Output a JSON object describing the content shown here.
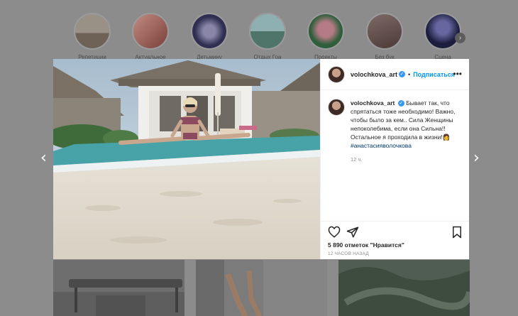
{
  "stories": [
    {
      "label": "Репетиции",
      "color": "#7d6f60"
    },
    {
      "label": "Актуальное",
      "color": "#a2675f"
    },
    {
      "label": "Детьмину",
      "color": "#3a3c5e"
    },
    {
      "label": "Отдых Гоа",
      "color": "#5c8077"
    },
    {
      "label": "Проекты",
      "color": "#3f6a48"
    },
    {
      "label": "Без бук",
      "color": "#6a5550"
    },
    {
      "label": "Сцена",
      "color": "#292a4d"
    }
  ],
  "nav": {
    "prev_glyph": "‹",
    "next_glyph": "›",
    "story_next_glyph": "›"
  },
  "post": {
    "username": "volochkova_art",
    "verified_glyph": "✓",
    "dot": "•",
    "follow_label": "Подписаться",
    "more_glyph": "•••",
    "caption_text": "Бывает так, что спрятаться тоже необходимо! Важно, чтобы было за кем.. Сила Женщины непоколебима, если она Сильна!! Остальное я проходила в жизни!",
    "caption_emoji": "👩",
    "hashtag": "#анастасияволочкова",
    "caption_time": "12 ч.",
    "likes": "5 890 отметок \"Нравится\"",
    "time_ago": "12 ЧАСОВ НАЗАД"
  },
  "icons": [
    "like-icon",
    "share-icon",
    "save-icon",
    "more-icon",
    "verified-icon"
  ]
}
